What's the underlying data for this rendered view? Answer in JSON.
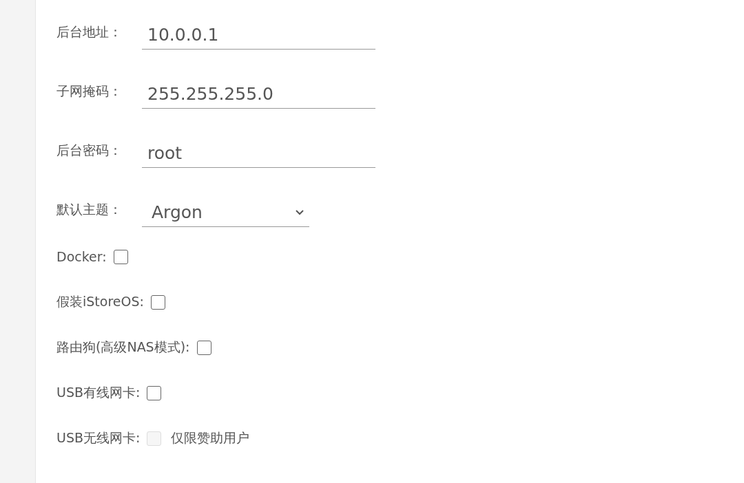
{
  "fields": [
    {
      "kind": "text",
      "label": "后台地址：",
      "value": "10.0.0.1"
    },
    {
      "kind": "text",
      "label": "子网掩码：",
      "value": "255.255.255.0"
    },
    {
      "kind": "text",
      "label": "后台密码：",
      "value": "root"
    },
    {
      "kind": "select",
      "label": "默认主题：",
      "value": "Argon"
    }
  ],
  "options": [
    {
      "label": "Docker:",
      "checked": false,
      "disabled": false
    },
    {
      "label": "假装iStoreOS:",
      "checked": false,
      "disabled": false
    },
    {
      "label": "路由狗(高级NAS模式):",
      "checked": false,
      "disabled": false
    },
    {
      "label": "USB有线网卡:",
      "checked": false,
      "disabled": false
    },
    {
      "label": "USB无线网卡:",
      "checked": false,
      "disabled": true,
      "note": "仅限赞助用户"
    }
  ]
}
